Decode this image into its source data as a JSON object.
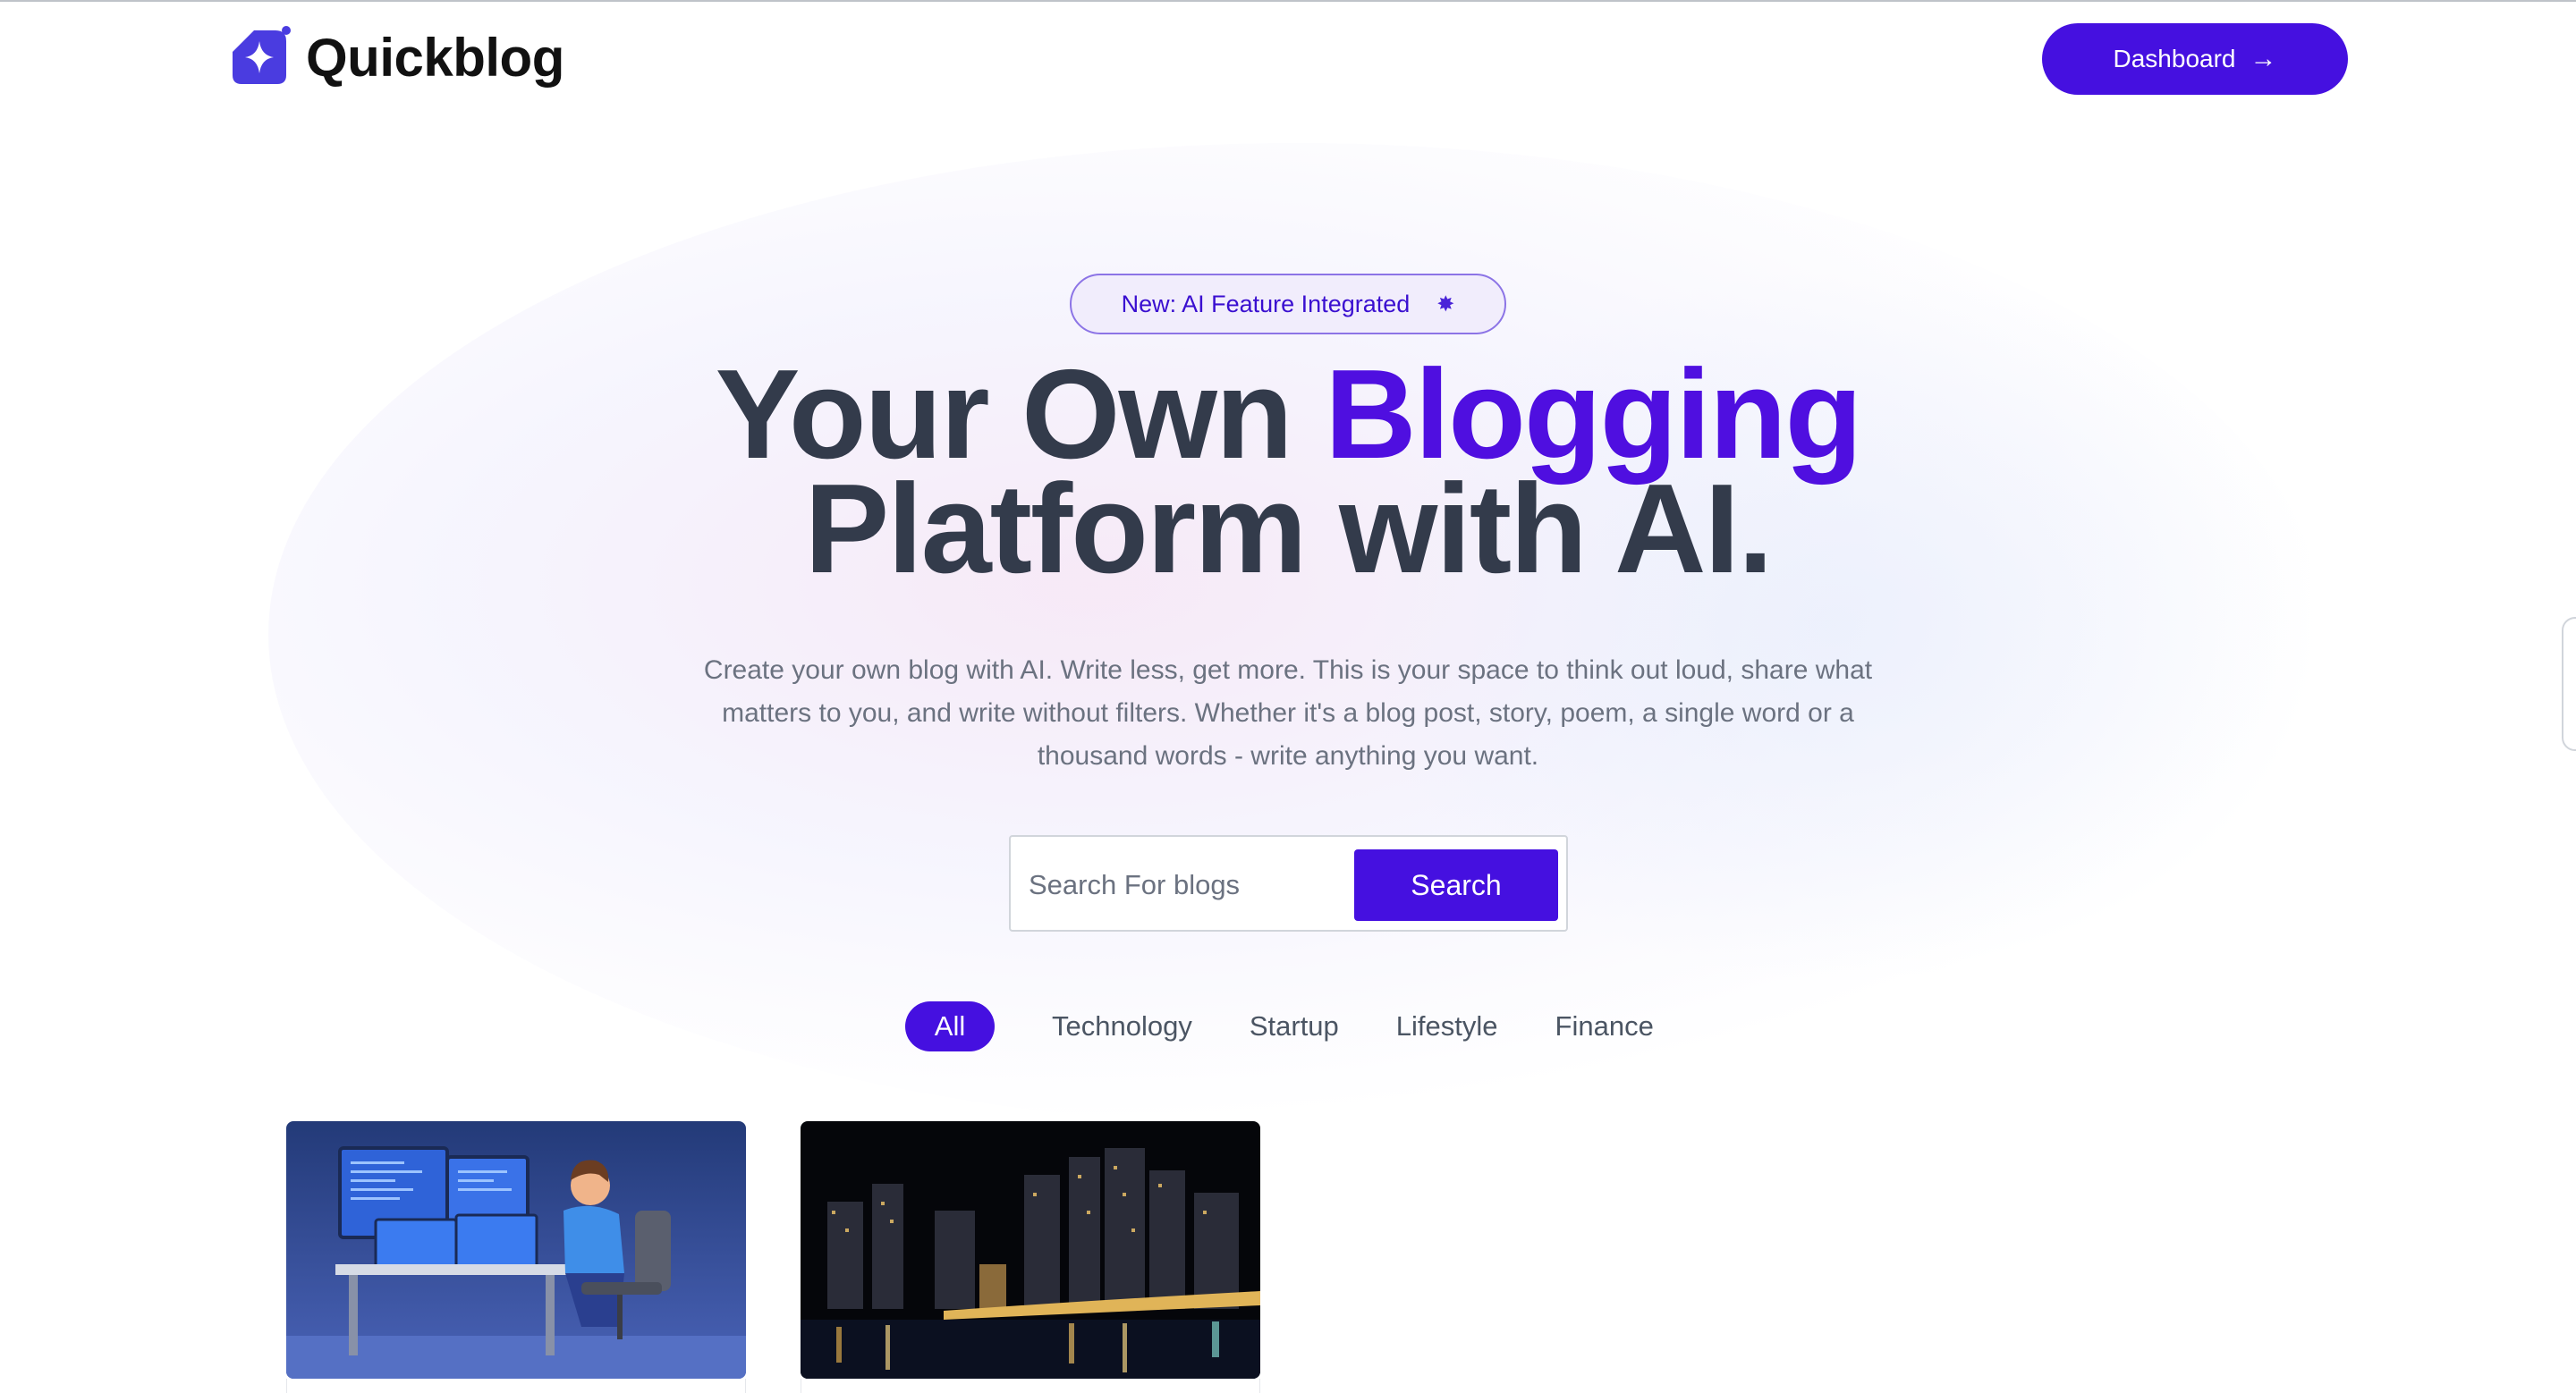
{
  "brand": {
    "name": "Quickblog",
    "logo_icon": "sparkle-logo-icon"
  },
  "header": {
    "dashboard_label": "Dashboard",
    "dashboard_icon": "arrow-right-icon"
  },
  "hero": {
    "badge_text": "New: AI Feature Integrated",
    "badge_icon": "star-icon",
    "headline_part1": "Your Own ",
    "headline_accent": "Blogging",
    "headline_part2": "Platform with AI.",
    "subtext": "Create your own blog with AI. Write less, get more. This is your space to think out loud, share what matters to you, and write without filters. Whether it's a blog post, story, poem, a single word or a thousand words - write anything you want."
  },
  "search": {
    "placeholder": "Search For blogs",
    "value": "",
    "button_label": "Search"
  },
  "categories": [
    {
      "label": "All",
      "active": true
    },
    {
      "label": "Technology",
      "active": false
    },
    {
      "label": "Startup",
      "active": false
    },
    {
      "label": "Lifestyle",
      "active": false
    },
    {
      "label": "Finance",
      "active": false
    }
  ],
  "colors": {
    "accent": "#4510e0",
    "headline": "#333b4b",
    "body_text": "#6b7280"
  }
}
